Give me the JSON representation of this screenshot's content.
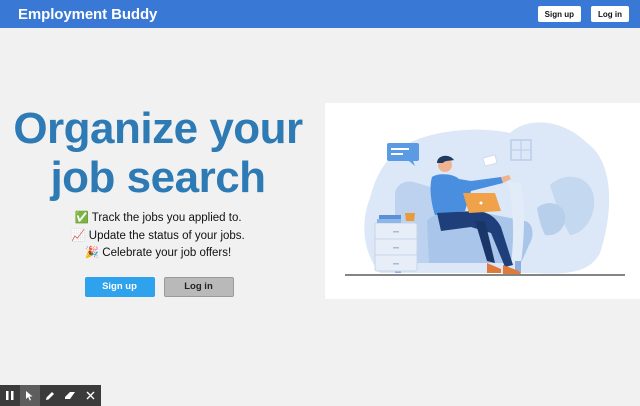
{
  "navbar": {
    "brand": "Employment Buddy",
    "signup_label": "Sign up",
    "login_label": "Log in"
  },
  "hero": {
    "headline_line1": "Organize your",
    "headline_line2": "job search",
    "features": [
      "✅ Track the jobs you applied to.",
      "📈 Update the status of your jobs.",
      "🎉 Celebrate your job offers!"
    ],
    "signup_label": "Sign up",
    "login_label": "Log in"
  },
  "colors": {
    "navbar": "#3a78d5",
    "headline": "#2d7ab5",
    "signup_button": "#2ea2ec",
    "login_button": "#b9b9b9",
    "background": "#f0f1f0"
  },
  "illustration": {
    "subject": "person-with-laptop-on-sofa"
  },
  "toolbar": {
    "icons": [
      "pause-icon",
      "pointer-icon",
      "pencil-icon",
      "eraser-icon",
      "close-icon"
    ]
  }
}
